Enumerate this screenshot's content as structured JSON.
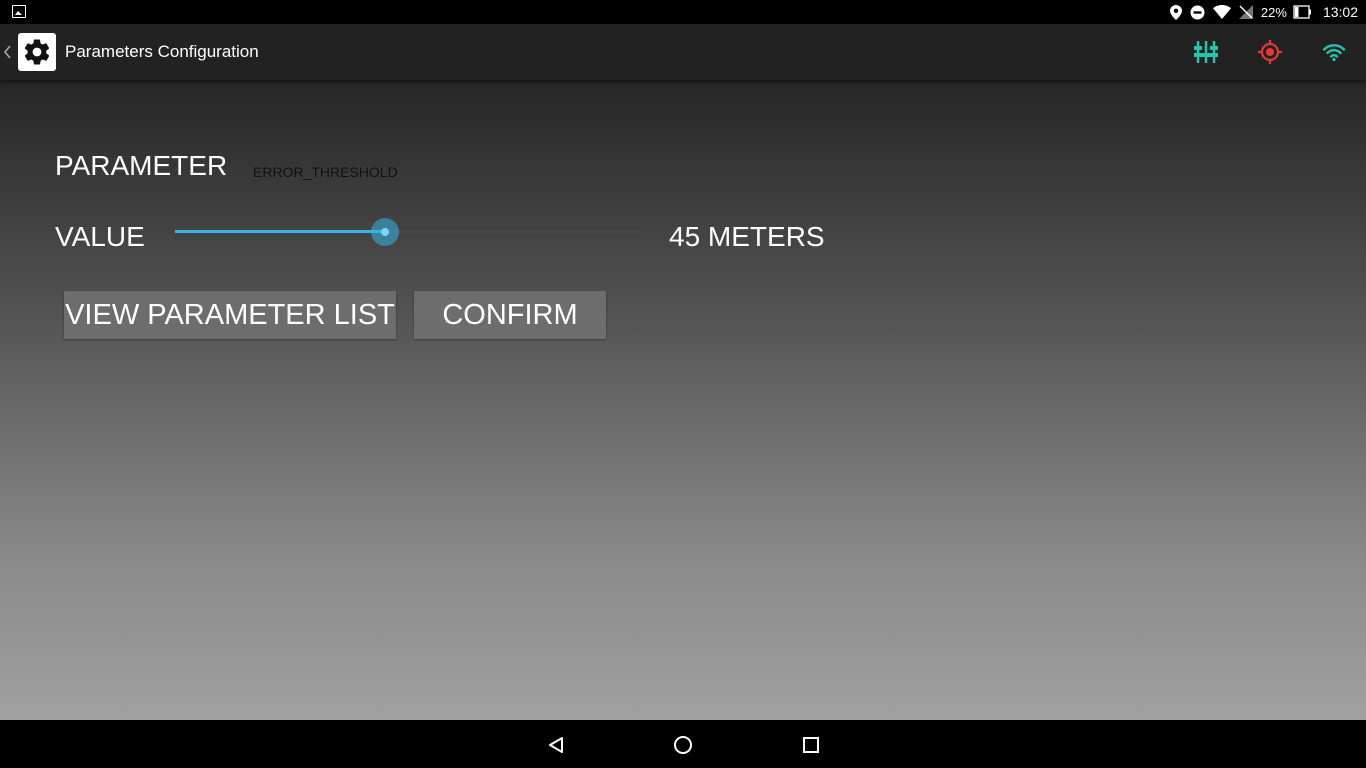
{
  "status_bar": {
    "icons": [
      "image-notification-icon",
      "location-icon",
      "do-not-disturb-icon",
      "wifi-signal-icon",
      "no-sim-icon",
      "battery-icon"
    ],
    "battery_percent": "22%",
    "time": "13:02"
  },
  "action_bar": {
    "title": "Parameters Configuration",
    "app_icon": "gear-icon",
    "back_icon": "chevron-left-icon",
    "action_icons": [
      {
        "name": "sliders-icon",
        "color": "#1fc7b0"
      },
      {
        "name": "gps-target-icon",
        "color": "#e53935"
      },
      {
        "name": "wifi-icon",
        "color": "#1fc7b0"
      }
    ]
  },
  "form": {
    "parameter_label": "PARAMETER",
    "parameter_name": "ERROR_THRESHOLD",
    "value_label": "VALUE",
    "value_readout": "45 METERS",
    "slider_fraction": 0.45,
    "accent_color": "#33b5e5"
  },
  "buttons": {
    "view_list": "VIEW PARAMETER LIST",
    "confirm": "CONFIRM"
  },
  "nav_bar": {
    "icons": [
      "back-triangle-icon",
      "home-circle-icon",
      "recents-square-icon"
    ]
  }
}
